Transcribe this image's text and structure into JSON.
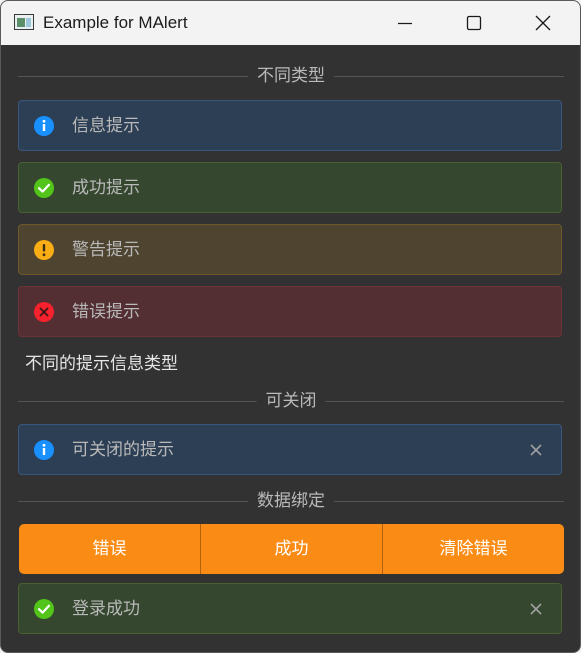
{
  "window": {
    "title": "Example for MAlert",
    "controls": [
      "minimize-icon",
      "maximize-icon",
      "close-icon"
    ]
  },
  "sections": {
    "types_header": "不同类型",
    "closable_header": "可关闭",
    "binding_header": "数据绑定"
  },
  "alerts": {
    "info": "信息提示",
    "success": "成功提示",
    "warning": "警告提示",
    "error": "错误提示"
  },
  "types_caption": "不同的提示信息类型",
  "closable_alert": {
    "text": "可关闭的提示",
    "icon": "info-icon"
  },
  "binding": {
    "buttons": [
      "错误",
      "成功",
      "清除错误"
    ],
    "result_alert": "登录成功"
  },
  "colors": {
    "info": "#1890ff",
    "success": "#52c41a",
    "warning": "#faad14",
    "error": "#f5222d",
    "button": "#fa8c16"
  }
}
